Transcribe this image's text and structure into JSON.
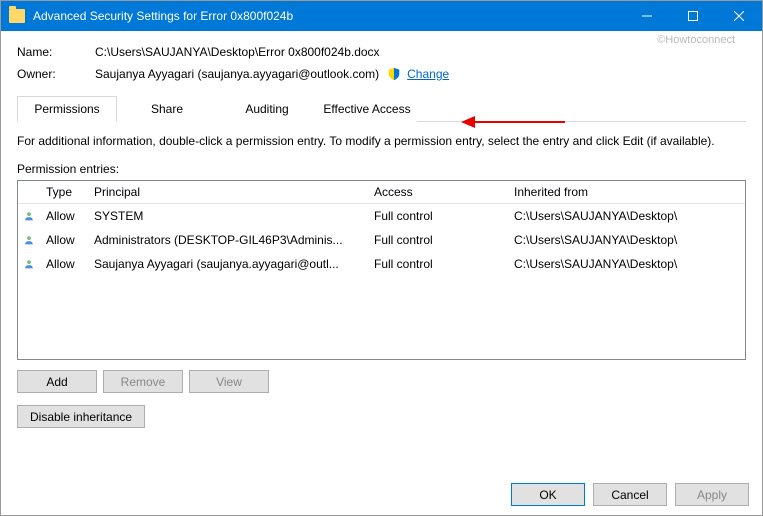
{
  "titlebar": {
    "title": "Advanced Security Settings for Error 0x800f024b"
  },
  "watermark": "©Howtoconnect",
  "name_label": "Name:",
  "name_value": "C:\\Users\\SAUJANYA\\Desktop\\Error 0x800f024b.docx",
  "owner_label": "Owner:",
  "owner_value": "Saujanya Ayyagari (saujanya.ayyagari@outlook.com)",
  "change_link": "Change",
  "tabs": {
    "permissions": "Permissions",
    "share": "Share",
    "auditing": "Auditing",
    "effective": "Effective Access"
  },
  "info_text": "For additional information, double-click a permission entry. To modify a permission entry, select the entry and click Edit (if available).",
  "entries_label": "Permission entries:",
  "columns": {
    "type": "Type",
    "principal": "Principal",
    "access": "Access",
    "inherited": "Inherited from"
  },
  "entries": [
    {
      "type": "Allow",
      "principal": "SYSTEM",
      "access": "Full control",
      "inherited": "C:\\Users\\SAUJANYA\\Desktop\\"
    },
    {
      "type": "Allow",
      "principal": "Administrators (DESKTOP-GIL46P3\\Adminis...",
      "access": "Full control",
      "inherited": "C:\\Users\\SAUJANYA\\Desktop\\"
    },
    {
      "type": "Allow",
      "principal": "Saujanya Ayyagari (saujanya.ayyagari@outl...",
      "access": "Full control",
      "inherited": "C:\\Users\\SAUJANYA\\Desktop\\"
    }
  ],
  "buttons": {
    "add": "Add",
    "remove": "Remove",
    "view": "View",
    "disable_inheritance": "Disable inheritance"
  },
  "footer": {
    "ok": "OK",
    "cancel": "Cancel",
    "apply": "Apply"
  }
}
